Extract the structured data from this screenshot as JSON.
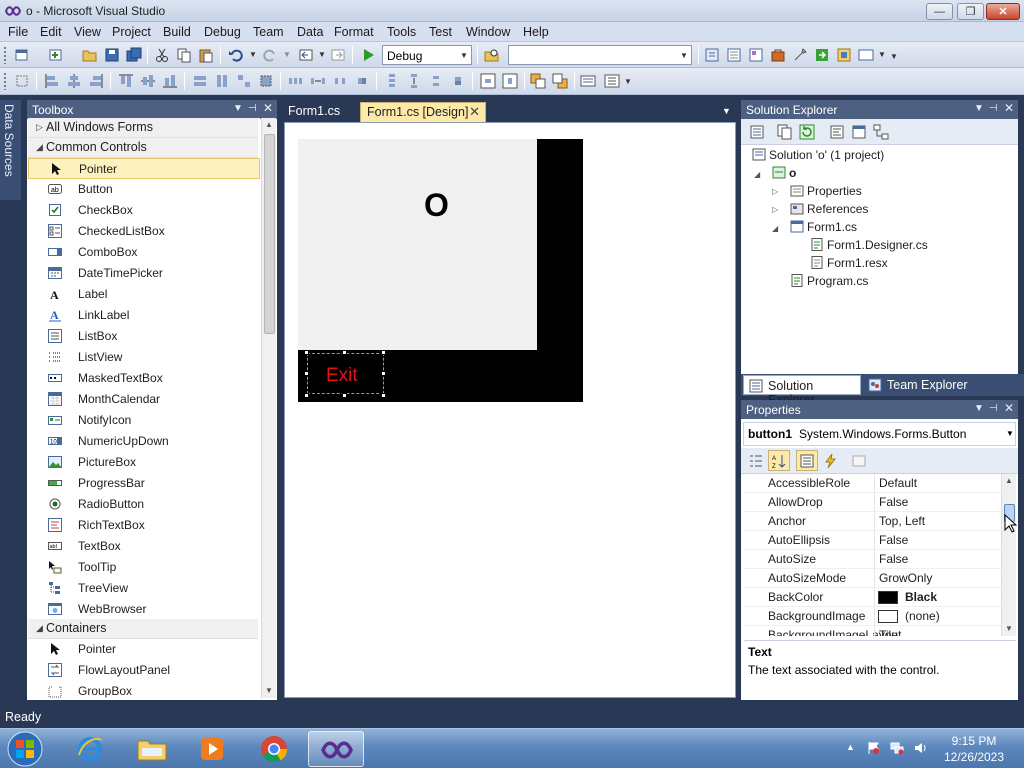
{
  "window": {
    "title": "o - Microsoft Visual Studio",
    "min_glyph": "—",
    "max_glyph": "❐",
    "close_glyph": "✕"
  },
  "menu": [
    "File",
    "Edit",
    "View",
    "Project",
    "Build",
    "Debug",
    "Team",
    "Data",
    "Format",
    "Tools",
    "Test",
    "Window",
    "Help"
  ],
  "toolbar": {
    "config_value": "Debug",
    "platform_value": ""
  },
  "side_tab": {
    "label": "Data Sources"
  },
  "toolbox": {
    "title": "Toolbox",
    "categories": {
      "all": "All Windows Forms",
      "common": "Common Controls",
      "containers": "Containers"
    },
    "common_items": [
      "Pointer",
      "Button",
      "CheckBox",
      "CheckedListBox",
      "ComboBox",
      "DateTimePicker",
      "Label",
      "LinkLabel",
      "ListBox",
      "ListView",
      "MaskedTextBox",
      "MonthCalendar",
      "NotifyIcon",
      "NumericUpDown",
      "PictureBox",
      "ProgressBar",
      "RadioButton",
      "RichTextBox",
      "TextBox",
      "ToolTip",
      "TreeView",
      "WebBrowser"
    ],
    "container_items": [
      "Pointer",
      "FlowLayoutPanel",
      "GroupBox"
    ]
  },
  "doc_tabs": [
    {
      "label": "Form1.cs"
    },
    {
      "label": "Form1.cs [Design]"
    }
  ],
  "form": {
    "label_text": "O",
    "exit_button_text": "Exit",
    "exit_text_color": "#e81010"
  },
  "solution_explorer": {
    "title": "Solution Explorer",
    "solution": "Solution 'o' (1 project)",
    "project": "o",
    "items": {
      "properties": "Properties",
      "references": "References",
      "form1": "Form1.cs",
      "designer": "Form1.Designer.cs",
      "resx": "Form1.resx",
      "program": "Program.cs"
    }
  },
  "bottom_tabs": {
    "solution_explorer": "Solution Explorer",
    "team_explorer": "Team Explorer"
  },
  "properties": {
    "title": "Properties",
    "object_name": "button1",
    "object_type": "System.Windows.Forms.Button",
    "rows": [
      {
        "name": "AccessibleRole",
        "value": "Default"
      },
      {
        "name": "AllowDrop",
        "value": "False"
      },
      {
        "name": "Anchor",
        "value": "Top, Left"
      },
      {
        "name": "AutoEllipsis",
        "value": "False"
      },
      {
        "name": "AutoSize",
        "value": "False"
      },
      {
        "name": "AutoSizeMode",
        "value": "GrowOnly"
      },
      {
        "name": "BackColor",
        "value": "Black"
      },
      {
        "name": "BackgroundImage",
        "value": "(none)"
      },
      {
        "name": "BackgroundImageLayout",
        "value": "Tile"
      }
    ],
    "backcolor_swatch": "#000000",
    "bgimage_swatch": "#ffffff",
    "desc_title": "Text",
    "desc_text": "The text associated with the control."
  },
  "status": {
    "text": "Ready"
  },
  "taskbar": {
    "time": "9:15 PM",
    "date": "12/26/2023"
  }
}
